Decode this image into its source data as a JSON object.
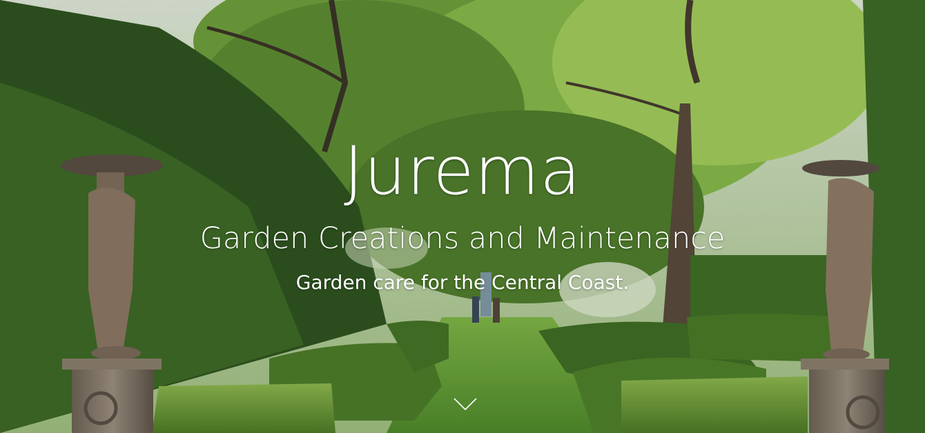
{
  "hero": {
    "title": "Jurema",
    "tagline": "Garden Creations and Maintenance",
    "subtitle": "Garden care for the Central Coast.",
    "scroll_icon": "chevron-down-icon",
    "background_image": "formal-garden-with-hedges-and-statues"
  },
  "colors": {
    "text": "#ffffff",
    "foliage_dark": "#2c4a1c",
    "foliage_light": "#8cc24a",
    "lawn": "#6aa43a"
  }
}
